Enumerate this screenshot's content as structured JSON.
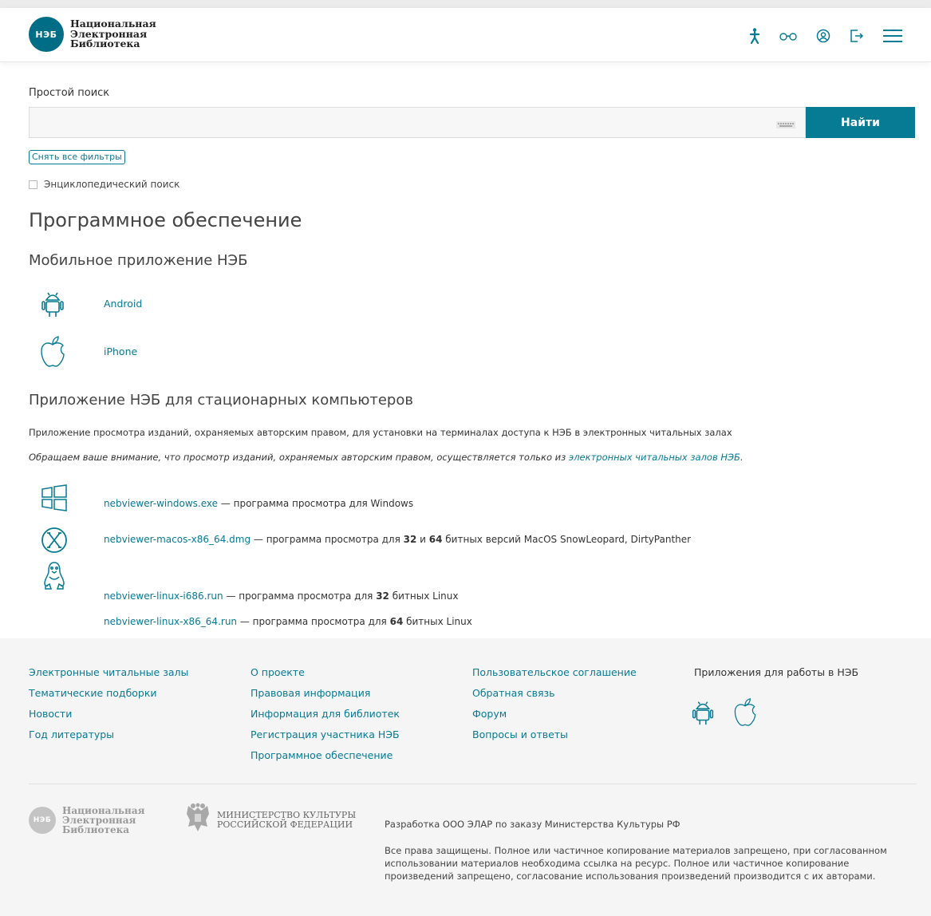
{
  "header": {
    "logo_abbr": "НЭБ",
    "logo_lines": [
      "Национальная",
      "Электронная",
      "Библиотека"
    ],
    "icons": [
      "accessibility-icon",
      "glasses-icon",
      "user-icon",
      "logout-icon",
      "menu-icon"
    ],
    "accent_color": "#077a94"
  },
  "search": {
    "label": "Простой поиск",
    "value": "",
    "button_label": "Найти",
    "reset_filters_label": "Снять все фильтры",
    "encyclopedic_label": "Энциклопедический поиск"
  },
  "main": {
    "title": "Программное обеспечение",
    "mobile": {
      "heading": "Мобильное приложение НЭБ",
      "apps": [
        {
          "label": "Android",
          "icon": "android-icon"
        },
        {
          "label": "iPhone",
          "icon": "apple-icon"
        }
      ]
    },
    "desktop": {
      "heading": "Приложение НЭБ для стационарных компьютеров",
      "description": "Приложение просмотра изданий, охраняемых авторским правом, для установки на терминалах доступа к НЭБ в электронных читальных залах",
      "notice_text": "Обращаем ваше внимание, что просмотр изданий, охраняемых авторским правом, осуществляется только из ",
      "notice_link": "электронных читальных залов НЭБ",
      "notice_end": ".",
      "downloads": {
        "windows": {
          "file": "nebviewer-windows.exe",
          "text": " — программа просмотра для Windows"
        },
        "macos": {
          "file": "nebviewer-macos-x86_64.dmg",
          "text1": " — программа просмотра для ",
          "b1": "32",
          "text2": " и ",
          "b2": "64",
          "text3": " битных версий MacOS SnowLeopard, DirtyPanther"
        },
        "linux_i686": {
          "file": "nebviewer-linux-i686.run",
          "text1": " — программа просмотра для ",
          "b1": "32",
          "text2": " битных Linux"
        },
        "linux_x86_64": {
          "file": "nebviewer-linux-x86_64.run",
          "text1": " — программа просмотра для ",
          "b1": "64",
          "text2": " битных Linux"
        }
      }
    }
  },
  "footer": {
    "col1": [
      "Электронные читальные залы",
      "Тематические подборки",
      "Новости",
      "Год литературы"
    ],
    "col2": [
      "О проекте",
      "Правовая информация",
      "Информация для библиотек",
      "Регистрация участника НЭБ",
      "Программное обеспечение"
    ],
    "col3": [
      "Пользовательское соглашение",
      "Обратная связь",
      "Форум",
      "Вопросы и ответы"
    ],
    "apps_title": "Приложения для работы в НЭБ",
    "logo_abbr": "НЭБ",
    "logo_lines": [
      "Национальная",
      "Электронная",
      "Библиотека"
    ],
    "ministry_lines": [
      "МИНИСТЕРСТВО КУЛЬТУРЫ",
      "РОССИЙСКОЙ ФЕДЕРАЦИИ"
    ],
    "developer": "Разработка ООО ЭЛАР по заказу Министерства Культуры РФ",
    "rights": "Все права защищены. Полное или частичное копирование материалов запрещено, при согласованном использовании материалов необходима ссылка на ресурс. Полное или частичное копирование произведений запрещено, согласование использования произведений производится с их авторами."
  }
}
